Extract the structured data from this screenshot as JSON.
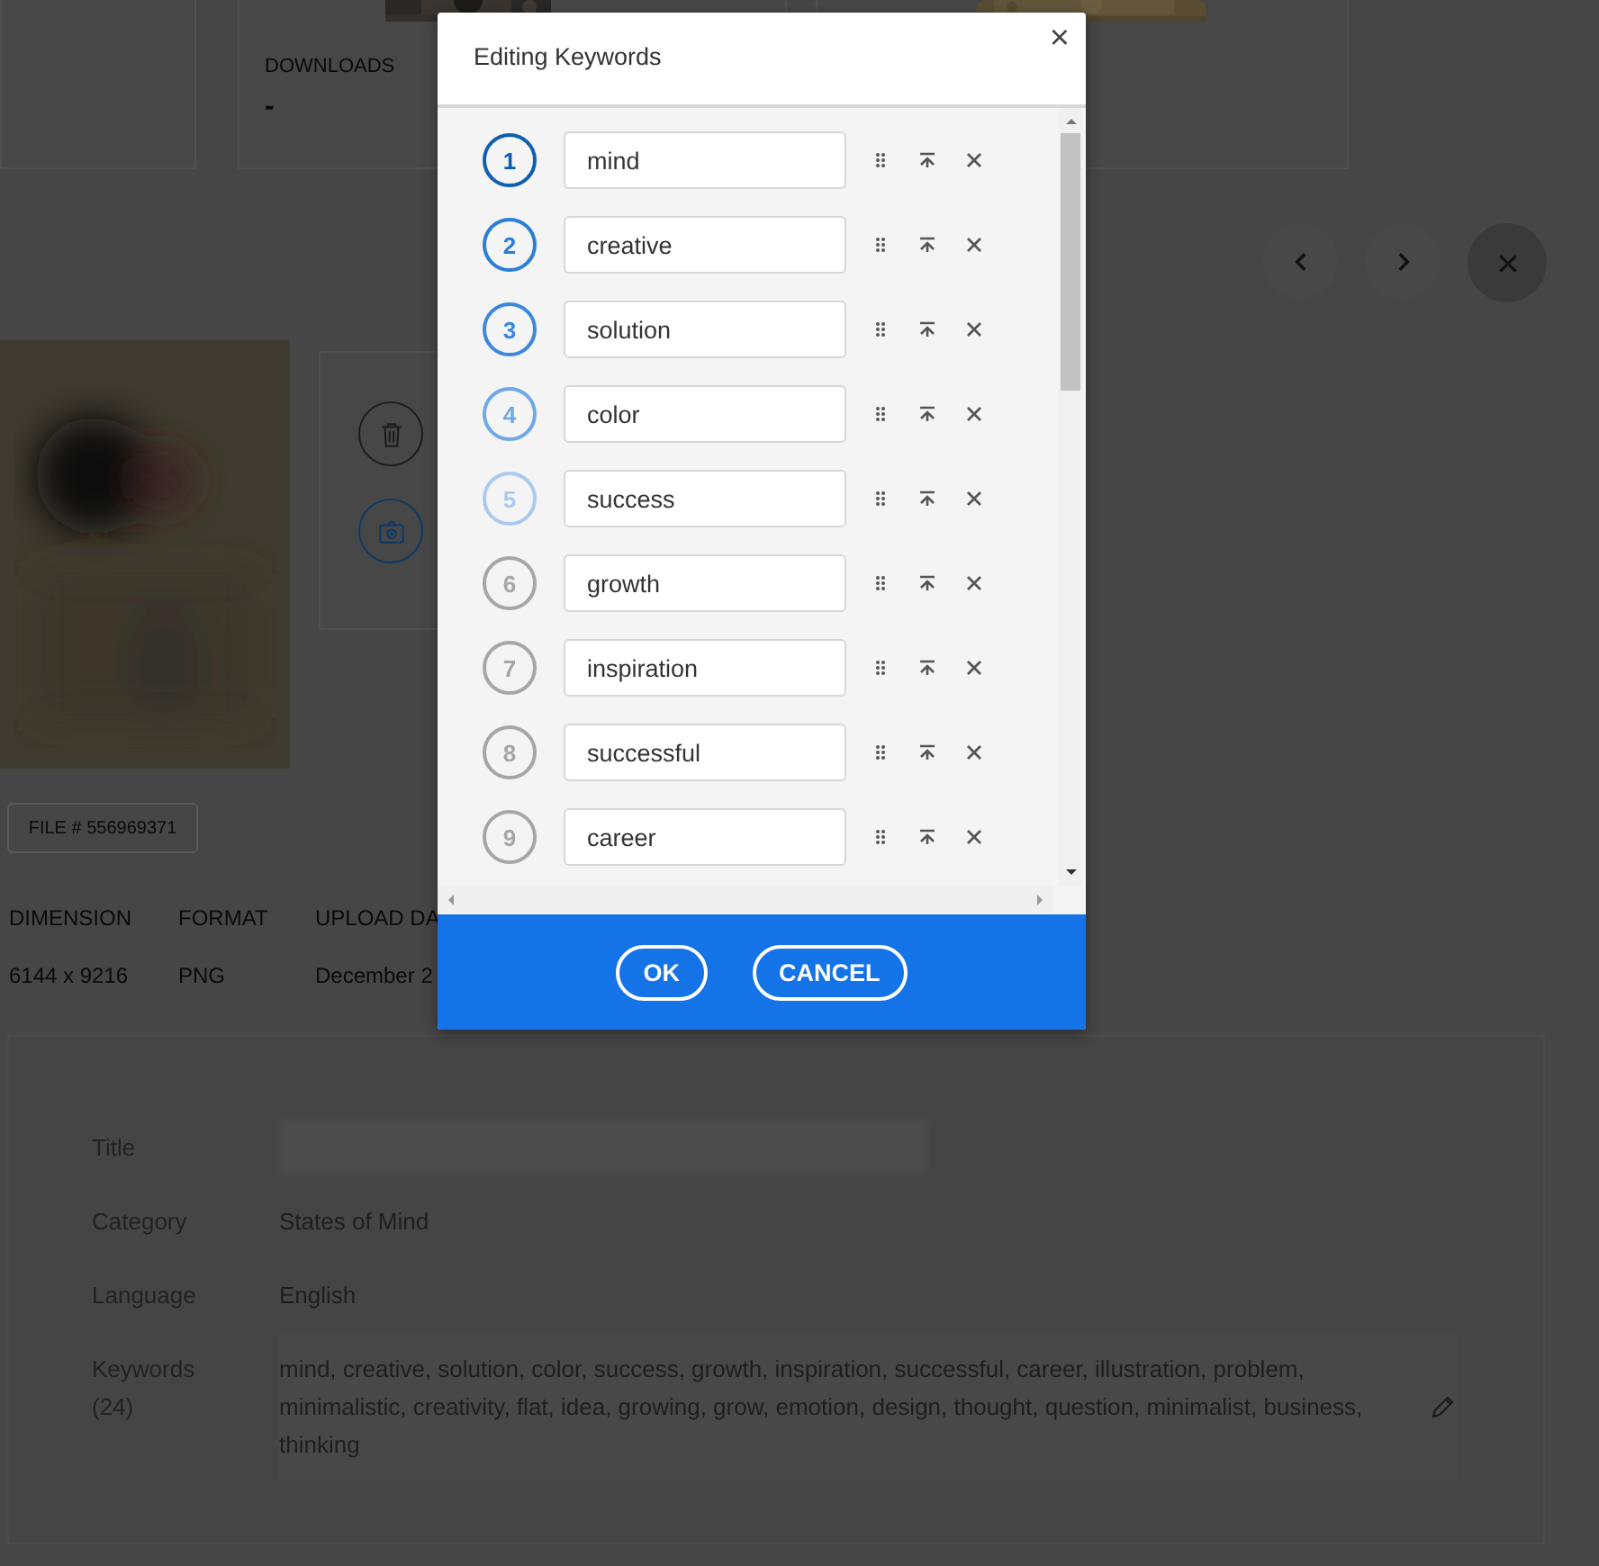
{
  "stats": {
    "label": "DOWNLOADS",
    "value": "-"
  },
  "file_number": "FILE # 556969371",
  "metadata": [
    {
      "label": "DIMENSION",
      "value": "6144 x 9216"
    },
    {
      "label": "FORMAT",
      "value": "PNG"
    },
    {
      "label": "UPLOAD DA",
      "value": "December 2"
    }
  ],
  "details": [
    {
      "kind": "redacted",
      "label": "Title"
    },
    {
      "kind": "text",
      "label": "Category",
      "value": "States of Mind"
    },
    {
      "kind": "text",
      "label": "Language",
      "value": "English"
    },
    {
      "kind": "keywords",
      "label": "Keywords (24)",
      "value": "mind, creative, solution, color, success, growth, inspiration, successful, career, illustration, problem, minimalistic, creativity, flat, idea, growing, grow, emotion, design, thought, question, minimalist, business, thinking"
    }
  ],
  "dialog": {
    "title": "Editing Keywords",
    "close": "×",
    "keywords": [
      {
        "number": "1",
        "value": "mind",
        "color": "#0d5fb0"
      },
      {
        "number": "2",
        "value": "creative",
        "color": "#2b7fd6"
      },
      {
        "number": "3",
        "value": "solution",
        "color": "#3b88dc"
      },
      {
        "number": "4",
        "value": "color",
        "color": "#6ea8e6"
      },
      {
        "number": "5",
        "value": "success",
        "color": "#aacaef"
      },
      {
        "number": "6",
        "value": "growth",
        "color": "#a6a6a6"
      },
      {
        "number": "7",
        "value": "inspiration",
        "color": "#a6a6a6"
      },
      {
        "number": "8",
        "value": "successful",
        "color": "#a6a6a6"
      },
      {
        "number": "9",
        "value": "career",
        "color": "#a6a6a6"
      }
    ],
    "buttons": [
      "OK",
      "CANCEL"
    ]
  }
}
